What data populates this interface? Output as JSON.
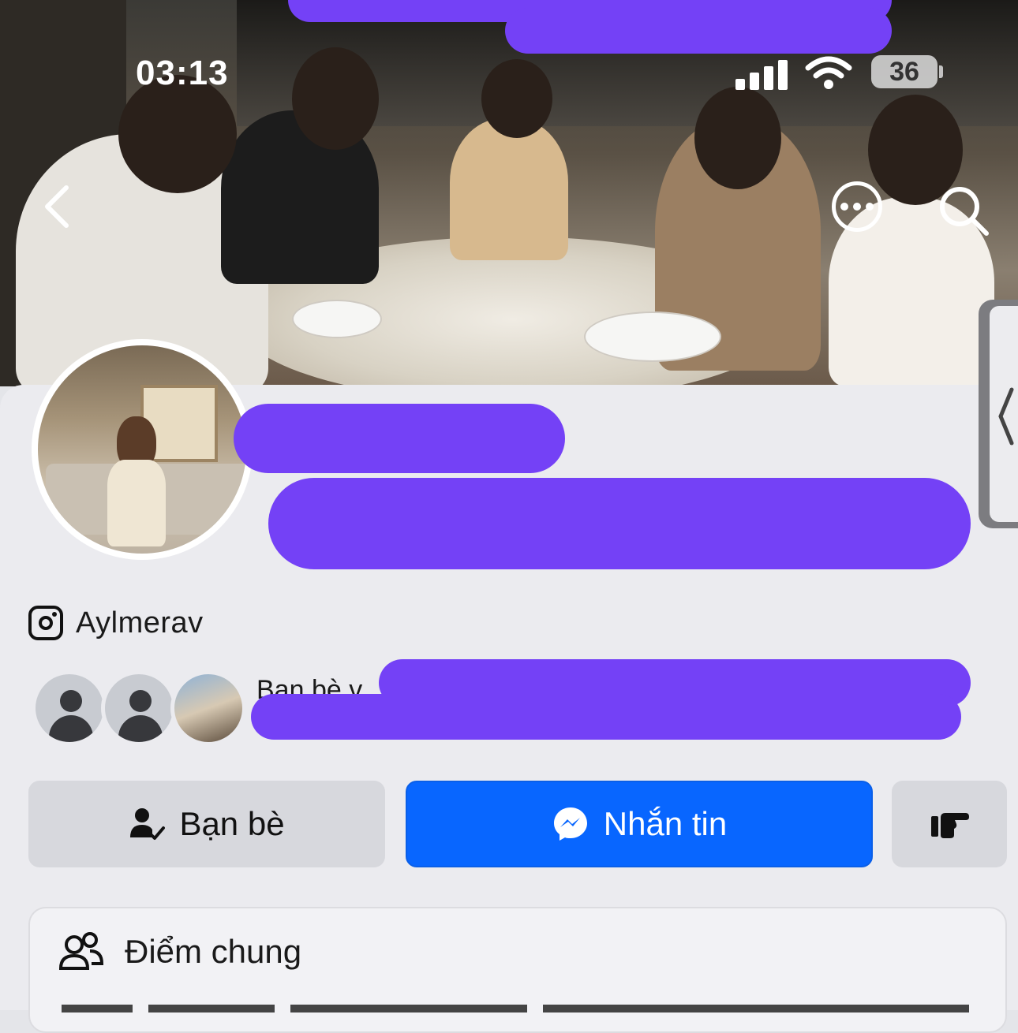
{
  "status_bar": {
    "time": "03:13",
    "battery": "36"
  },
  "profile": {
    "instagram_handle": "Aylmerav",
    "mutual_friends_text": "Bạn bè v"
  },
  "actions": {
    "friends_label": "Bạn bè",
    "message_label": "Nhắn tin"
  },
  "common": {
    "title": "Điểm chung"
  },
  "icons": {
    "back": "chevron-left-icon",
    "more": "more-dots-icon",
    "search": "search-icon",
    "instagram": "instagram-icon",
    "friends": "friend-check-icon",
    "messenger": "messenger-icon",
    "poke": "poke-hand-icon",
    "common": "people-icon"
  },
  "colors": {
    "primary_blue": "#0866ff",
    "redaction": "#7441f6",
    "background": "#ebebef"
  }
}
